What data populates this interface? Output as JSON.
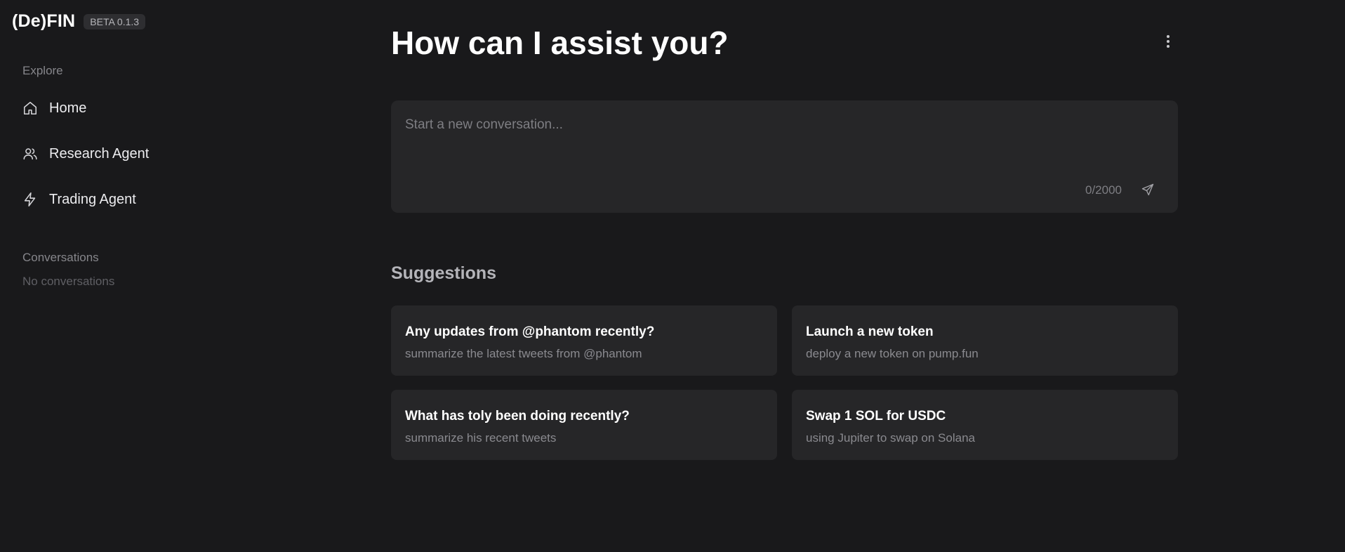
{
  "brand": {
    "name": "(De)FIN",
    "badge": "BETA 0.1.3"
  },
  "sidebar": {
    "explore_label": "Explore",
    "items": [
      {
        "label": "Home",
        "icon": "home-icon"
      },
      {
        "label": "Research Agent",
        "icon": "users-icon"
      },
      {
        "label": "Trading Agent",
        "icon": "zap-icon"
      }
    ],
    "conversations_label": "Conversations",
    "empty_text": "No conversations"
  },
  "main": {
    "title": "How can I assist you?",
    "composer": {
      "placeholder": "Start a new conversation...",
      "value": "",
      "char_count": "0/2000"
    },
    "suggestions_title": "Suggestions",
    "suggestions": [
      {
        "title": "Any updates from @phantom recently?",
        "subtitle": "summarize the latest tweets from @phantom"
      },
      {
        "title": "Launch a new token",
        "subtitle": "deploy a new token on pump.fun"
      },
      {
        "title": "What has toly been doing recently?",
        "subtitle": "summarize his recent tweets"
      },
      {
        "title": "Swap 1 SOL for USDC",
        "subtitle": "using Jupiter to swap on Solana"
      }
    ]
  },
  "colors": {
    "background": "#19191b",
    "surface": "#262628",
    "text_primary": "#ffffff",
    "text_muted": "#8a8a8f"
  }
}
